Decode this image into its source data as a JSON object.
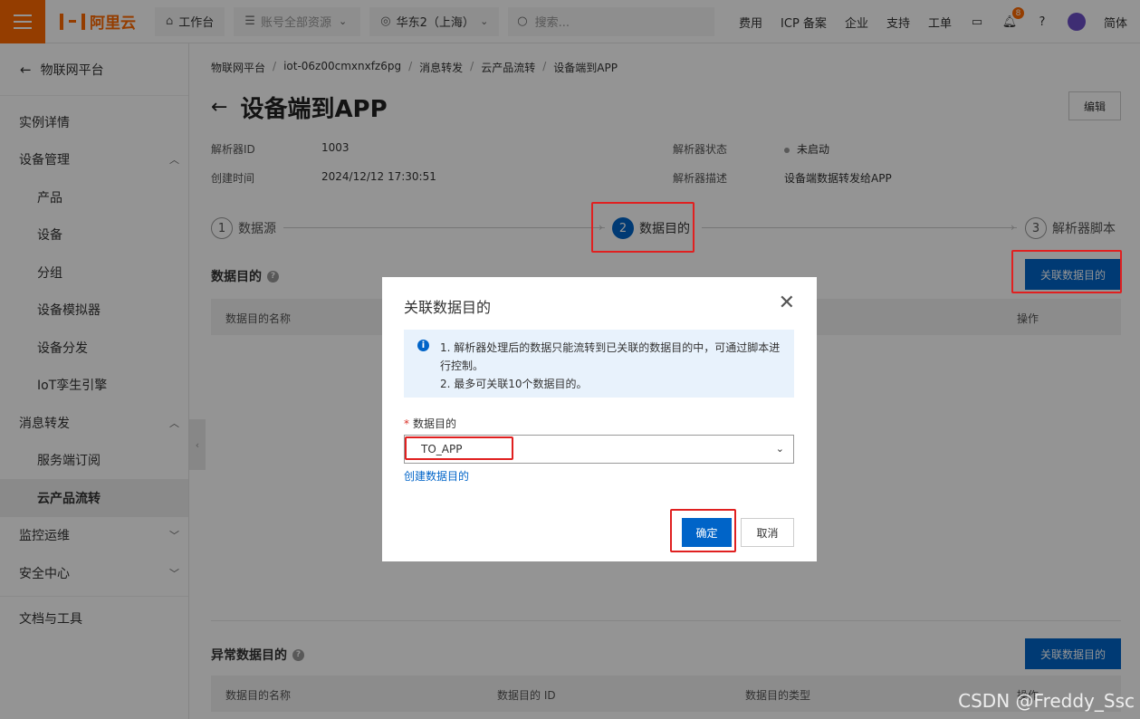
{
  "topbar": {
    "logo_text": "阿里云",
    "workbench": "工作台",
    "account_resources": "账号全部资源",
    "region": "华东2（上海）",
    "search_placeholder": "搜索...",
    "links": [
      "费用",
      "ICP 备案",
      "企业",
      "支持",
      "工单"
    ],
    "notification_count": "8",
    "language": "简体",
    "accent_color": "#ff6a00"
  },
  "sidebar": {
    "back_label": "物联网平台",
    "items": [
      {
        "label": "实例详情",
        "sub": false
      },
      {
        "label": "设备管理",
        "sub": false,
        "expand": "up"
      },
      {
        "label": "产品",
        "sub": true
      },
      {
        "label": "设备",
        "sub": true
      },
      {
        "label": "分组",
        "sub": true
      },
      {
        "label": "设备模拟器",
        "sub": true
      },
      {
        "label": "设备分发",
        "sub": true
      },
      {
        "label": "IoT孪生引擎",
        "sub": true
      },
      {
        "label": "消息转发",
        "sub": false,
        "expand": "up"
      },
      {
        "label": "服务端订阅",
        "sub": true
      },
      {
        "label": "云产品流转",
        "sub": true,
        "active": true
      },
      {
        "label": "监控运维",
        "sub": false,
        "expand": "down"
      },
      {
        "label": "安全中心",
        "sub": false,
        "expand": "down"
      }
    ],
    "footer_item": "文档与工具"
  },
  "breadcrumb": [
    "物联网平台",
    "iot-06z00cmxnxfz6pg",
    "消息转发",
    "云产品流转",
    "设备端到APP"
  ],
  "page": {
    "title": "设备端到APP",
    "edit_label": "编辑",
    "info": {
      "parser_id_label": "解析器ID",
      "parser_id": "1003",
      "created_label": "创建时间",
      "created": "2024/12/12 17:30:51",
      "status_label": "解析器状态",
      "status": "未启动",
      "desc_label": "解析器描述",
      "desc": "设备端数据转发给APP"
    },
    "steps": [
      {
        "num": "1",
        "label": "数据源"
      },
      {
        "num": "2",
        "label": "数据目的",
        "current": true
      },
      {
        "num": "3",
        "label": "解析器脚本"
      }
    ],
    "dest_section": {
      "title": "数据目的",
      "button": "关联数据目的",
      "columns": [
        "数据目的名称",
        "操作"
      ]
    },
    "error_section": {
      "title": "异常数据目的",
      "button": "关联数据目的",
      "columns": [
        "数据目的名称",
        "数据目的 ID",
        "数据目的类型",
        "操作"
      ]
    }
  },
  "dialog": {
    "title": "关联数据目的",
    "notice_line1": "1. 解析器处理后的数据只能流转到已关联的数据目的中，可通过脚本进",
    "notice_line2": "行控制。",
    "notice_line3": "2. 最多可关联10个数据目的。",
    "field_label": "数据目的",
    "field_value": "TO_APP",
    "create_link": "创建数据目的",
    "ok_label": "确定",
    "cancel_label": "取消"
  },
  "watermark": "CSDN @Freddy_Ssc",
  "highlight_color": "#e02020",
  "primary_color": "#0064c8"
}
